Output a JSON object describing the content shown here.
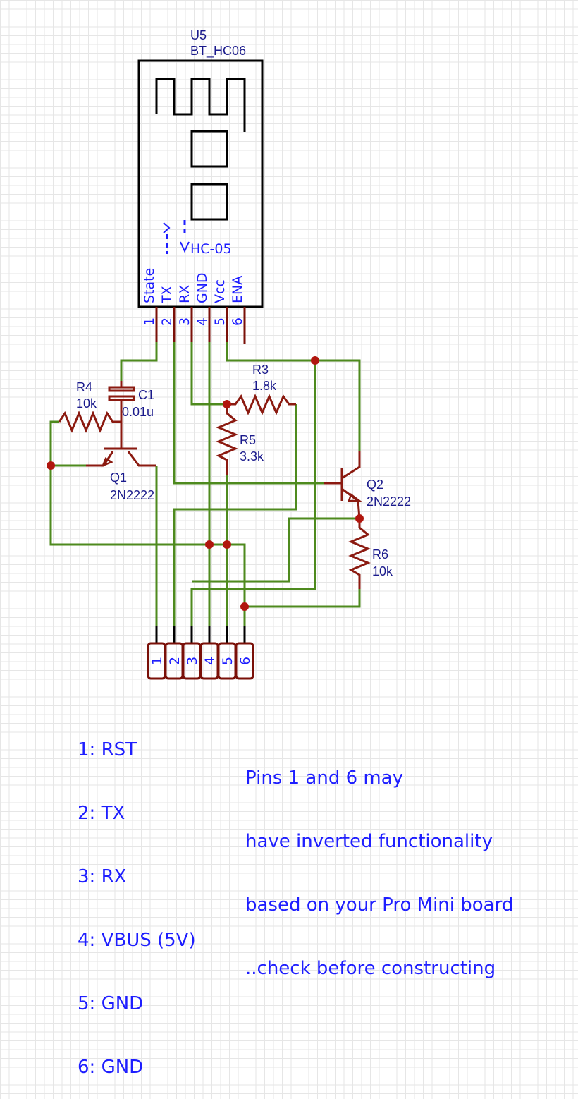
{
  "module": {
    "ref": "U5",
    "value": "BT_HC06",
    "inner_label": "HC-05",
    "pins": [
      {
        "num": "1",
        "name": "State"
      },
      {
        "num": "2",
        "name": "TX"
      },
      {
        "num": "3",
        "name": "RX"
      },
      {
        "num": "4",
        "name": "GND"
      },
      {
        "num": "5",
        "name": "Vcc"
      },
      {
        "num": "6",
        "name": "ENA"
      }
    ]
  },
  "components": {
    "r3": {
      "ref": "R3",
      "value": "1.8k"
    },
    "r4": {
      "ref": "R4",
      "value": "10k"
    },
    "r5": {
      "ref": "R5",
      "value": "3.3k"
    },
    "r6": {
      "ref": "R6",
      "value": "10k"
    },
    "c1": {
      "ref": "C1",
      "value": "0.01u"
    },
    "q1": {
      "ref": "Q1",
      "value": "2N2222"
    },
    "q2": {
      "ref": "Q2",
      "value": "2N2222"
    }
  },
  "header": {
    "pins": [
      "1",
      "2",
      "3",
      "4",
      "5",
      "6"
    ]
  },
  "pin_legend": [
    "1: RST",
    "2: TX",
    "3: RX",
    "4: VBUS (5V)",
    "5: GND",
    "6: GND"
  ],
  "note": [
    "Pins 1 and 6 may",
    "have inverted functionality",
    "based on your Pro Mini board",
    "..check before constructing"
  ]
}
